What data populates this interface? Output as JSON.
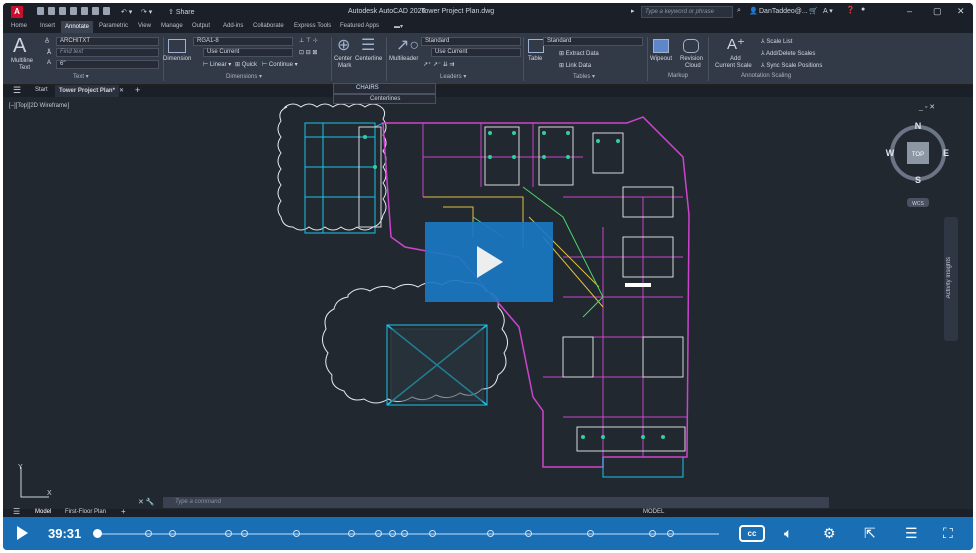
{
  "window": {
    "app_title": "Autodesk AutoCAD 2026",
    "doc_title": "Tower Project Plan.dwg",
    "search_placeholder": "Type a keyword or phrase",
    "user": "DanTaddeo@..."
  },
  "share_label": "Share",
  "tabs": [
    "Home",
    "Insert",
    "Annotate",
    "Parametric",
    "View",
    "Manage",
    "Output",
    "Add-ins",
    "Collaborate",
    "Express Tools",
    "Featured Apps"
  ],
  "active_tab": "Annotate",
  "ribbon": {
    "text": {
      "multiline": "Multiline",
      "text_label": "Text",
      "style": "ARCHITXT",
      "find": "Find text",
      "height": "6\"",
      "panel": "Text"
    },
    "dimensions": {
      "dimension": "Dimension",
      "style": "RGA1-8",
      "layer": "Use Current",
      "linear": "Linear",
      "quick": "Quick",
      "continue": "Continue",
      "panel": "Dimensions"
    },
    "centermark": {
      "center": "Center",
      "mark": "Mark",
      "centerline": "Centerline"
    },
    "leaders": {
      "multileader": "Multileader",
      "style": "Standard",
      "layer": "Use Current",
      "panel": "Leaders"
    },
    "tables": {
      "table": "Table",
      "style": "Standard",
      "extract": "Extract Data",
      "link": "Link Data",
      "panel": "Tables"
    },
    "markup": {
      "wipeout": "Wipeout",
      "revision": "Revision",
      "cloud": "Cloud",
      "panel": "Markup"
    },
    "scaling": {
      "add": "Add",
      "current_scale": "Current Scale",
      "scale_list": "Scale List",
      "add_delete": "Add/Delete Scales",
      "sync": "Sync Scale Positions",
      "panel": "Annotation Scaling"
    }
  },
  "doc_tabs": {
    "start": "Start",
    "current": "Tower Project Plan*"
  },
  "layer_dropdown": {
    "value": "CHAIRS",
    "item": "Centerlines"
  },
  "viewport_label": "[–][Top][2D Wireframe]",
  "viewcube": {
    "n": "N",
    "s": "S",
    "e": "E",
    "w": "W",
    "top": "TOP",
    "wcs": "WCS"
  },
  "activity_insights": "Activity Insights",
  "command_placeholder": "Type a command",
  "layout_tabs": {
    "model": "Model",
    "layout": "First-Floor Plan"
  },
  "status": {
    "model": "MODEL"
  },
  "player": {
    "time": "39:31",
    "progress": 0.0
  }
}
